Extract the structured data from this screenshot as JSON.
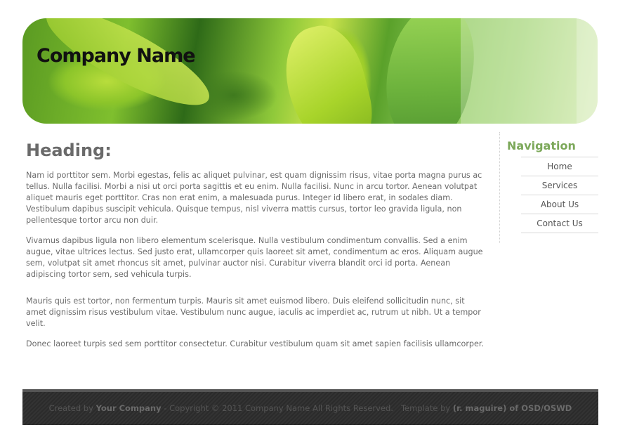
{
  "header": {
    "company_name": "Company Name"
  },
  "main": {
    "heading": "Heading:",
    "paragraphs": [
      "Nam id porttitor sem. Morbi egestas, felis ac aliquet pulvinar, est quam dignissim risus, vitae porta magna purus ac tellus. Nulla facilisi. Morbi a nisi ut orci porta sagittis et eu enim. Nulla facilisi. Nunc in arcu tortor. Aenean volutpat aliquet mauris eget porttitor. Cras non erat enim, a malesuada purus. Integer id libero erat, in sodales diam. Vestibulum dapibus suscipit vehicula. Quisque tempus, nisl viverra mattis cursus, tortor leo gravida ligula, non pellentesque tortor arcu non duir.",
      "Vivamus dapibus ligula non libero elementum scelerisque. Nulla vestibulum condimentum convallis. Sed a enim augue, vitae ultrices lectus. Sed justo erat, ullamcorper quis laoreet sit amet, condimentum ac eros. Aliquam augue sem, volutpat sit amet rhoncus sit amet, pulvinar auctor nisi. Curabitur viverra blandit orci id porta. Aenean adipiscing tortor sem, sed vehicula turpis.",
      "Mauris quis est tortor, non fermentum turpis. Mauris sit amet euismod libero. Duis eleifend sollicitudin nunc, sit amet dignissim risus vestibulum vitae. Vestibulum nunc augue, iaculis ac imperdiet ac, rutrum ut nibh. Ut a tempor velit.",
      "Donec laoreet turpis sed sem porttitor consectetur. Curabitur vestibulum quam sit amet sapien facilisis ullamcorper."
    ]
  },
  "sidebar": {
    "title": "Navigation",
    "items": [
      {
        "label": "Home"
      },
      {
        "label": "Services"
      },
      {
        "label": "About Us"
      },
      {
        "label": "Contact Us"
      }
    ]
  },
  "footer": {
    "created_prefix": "Created by",
    "created_company": "Your Company",
    "copyright": "- Copyright © 2011 Company Name All Rights Reserved.",
    "template_prefix": "Template by",
    "template_author": "(r. maguire) of OSD/OSWD"
  }
}
